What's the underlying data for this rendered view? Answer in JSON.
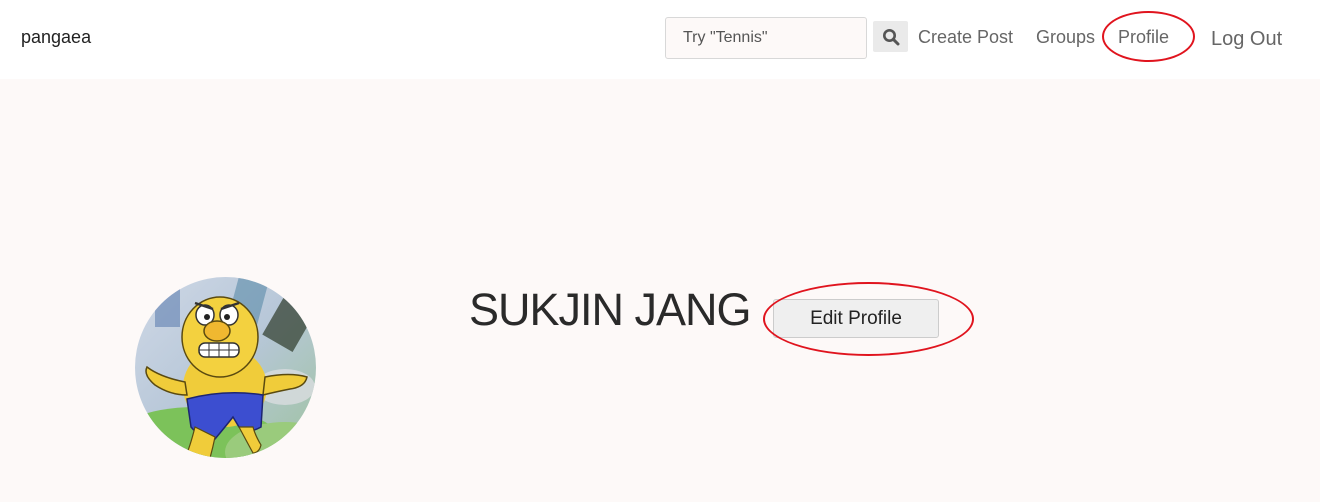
{
  "navbar": {
    "brand": "pangaea",
    "search": {
      "placeholder": "Try \"Tennis\"",
      "value": "",
      "button_icon": "search-icon"
    },
    "links": {
      "create_post": "Create Post",
      "groups": "Groups",
      "profile": "Profile",
      "log_out": "Log Out"
    }
  },
  "profile": {
    "name": "SUKJIN JANG",
    "edit_button_label": "Edit Profile",
    "avatar_icon": "cartoon-character-avatar"
  },
  "annotations": {
    "highlight_color": "#e0141e"
  },
  "colors": {
    "page_background": "#fdf9f8",
    "navbar_background": "#ffffff",
    "nav_link_color": "#666666"
  }
}
